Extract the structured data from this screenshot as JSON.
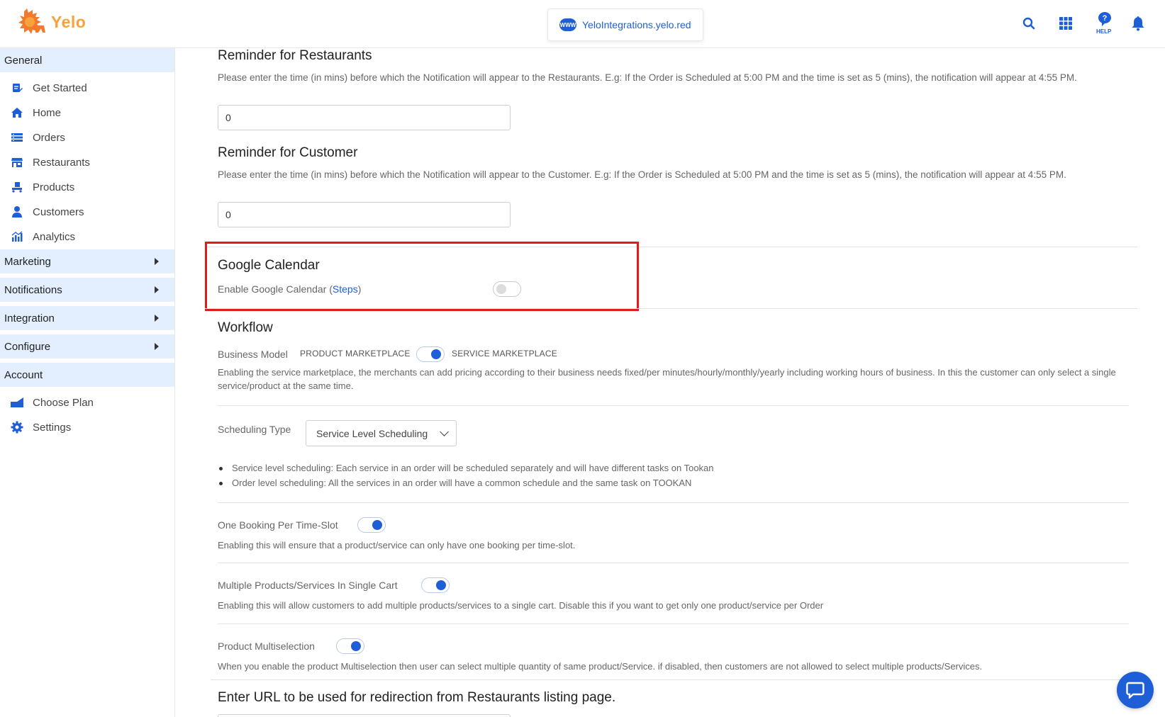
{
  "header": {
    "logo_text": "Yelo",
    "store_url": "YeloIntegrations.yelo.red",
    "www_badge": "WWW",
    "help_label": "HELP",
    "brand_color": "#f7a23b",
    "accent_color": "#1e5fd8",
    "icons": [
      "search-icon",
      "apps-grid-icon",
      "help-icon",
      "bell-icon"
    ]
  },
  "sidebar": {
    "general": "General",
    "general_items": [
      {
        "label": "Get Started",
        "icon": "get-started-icon"
      },
      {
        "label": "Home",
        "icon": "home-icon"
      },
      {
        "label": "Orders",
        "icon": "orders-icon"
      },
      {
        "label": "Restaurants",
        "icon": "restaurants-icon"
      },
      {
        "label": "Products",
        "icon": "products-icon"
      },
      {
        "label": "Customers",
        "icon": "customers-icon"
      },
      {
        "label": "Analytics",
        "icon": "analytics-icon"
      }
    ],
    "marketing": "Marketing",
    "notifications": "Notifications",
    "integration": "Integration",
    "configure": "Configure",
    "account": "Account",
    "account_items": [
      {
        "label": "Choose Plan",
        "icon": "choose-plan-icon"
      },
      {
        "label": "Settings",
        "icon": "settings-gear-icon"
      }
    ]
  },
  "main": {
    "reminder_restaurants": {
      "title": "Reminder for Restaurants",
      "desc": "Please enter the time (in mins) before which the Notification will appear to the Restaurants. E.g: If the Order is Scheduled at 5:00 PM and the time is set as 5 (mins), the notification will appear at 4:55 PM.",
      "value": "0"
    },
    "reminder_customer": {
      "title": "Reminder for Customer",
      "desc": "Please enter the time (in mins) before which the Notification will appear to the Customer. E.g: If the Order is Scheduled at 5:00 PM and the time is set as 5 (mins), the notification will appear at 4:55 PM.",
      "value": "0"
    },
    "google_calendar": {
      "title": "Google Calendar",
      "label_prefix": "Enable Google Calendar (",
      "steps_link": "Steps",
      "label_suffix": ")",
      "enabled": false
    },
    "workflow": {
      "title": "Workflow",
      "business_model_label": "Business Model",
      "product_marketplace": "PRODUCT MARKETPLACE",
      "service_marketplace": "SERVICE MARKETPLACE",
      "service_selected": true,
      "business_model_desc": "Enabling the service marketplace, the merchants can add pricing according to their business needs fixed/per minutes/hourly/monthly/yearly including working hours of business. In this the customer can only select a single service/product at the same time.",
      "scheduling_label": "Scheduling Type",
      "scheduling_value": "Service Level Scheduling",
      "scheduling_bullets": [
        "Service level scheduling: Each service in an order will be scheduled separately and will have different tasks on Tookan",
        "Order level scheduling: All the services in an order will have a common schedule and the same task on TOOKAN"
      ],
      "one_booking_label": "One Booking Per Time-Slot",
      "one_booking_enabled": true,
      "one_booking_desc": "Enabling this will ensure that a product/service can only have one booking per time-slot.",
      "multi_cart_label": "Multiple Products/Services In Single Cart",
      "multi_cart_enabled": true,
      "multi_cart_desc": "Enabling this will allow customers to add multiple products/services to a single cart. Disable this if you want to get only one product/service per Order",
      "multiselection_label": "Product Multiselection",
      "multiselection_enabled": true,
      "multiselection_desc": "When you enable the product Multiselection then user can select multiple quantity of same product/Service. if disabled, then customers are not allowed to select multiple products/Services."
    },
    "redirect_title": "Enter URL to be used for redirection from Restaurants listing page."
  }
}
